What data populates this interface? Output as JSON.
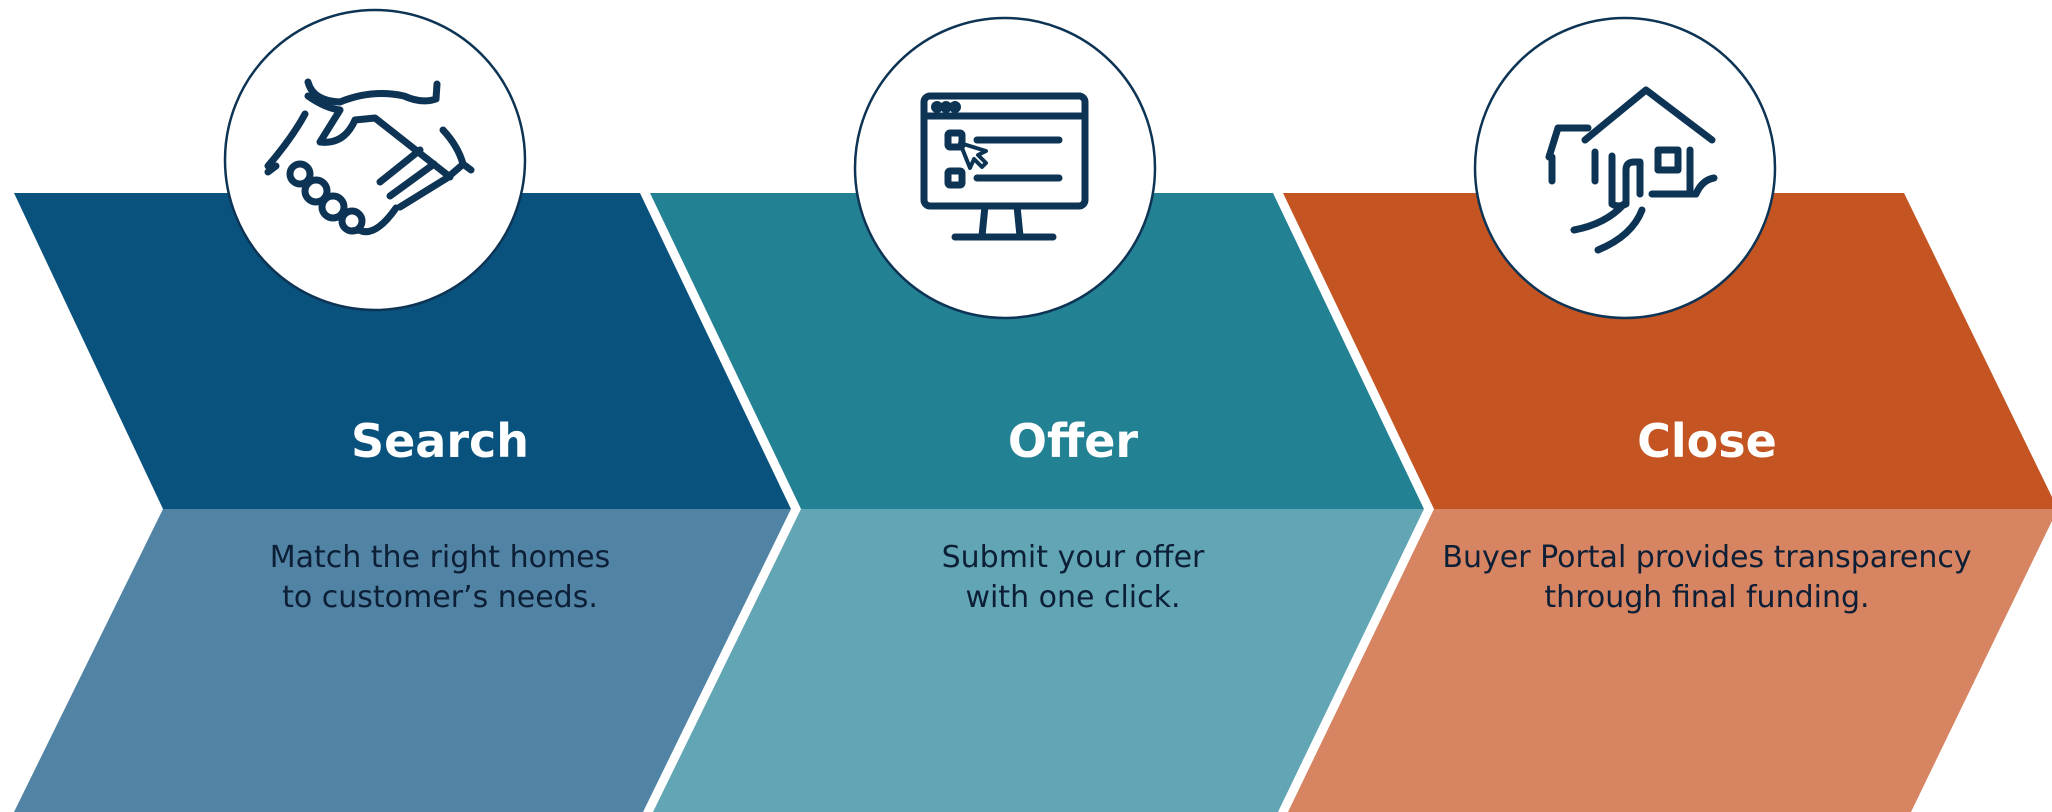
{
  "steps": [
    {
      "title": "Search",
      "description_lines": [
        "Match the right homes",
        "to customer’s needs."
      ],
      "icon": "handshake-icon",
      "top_color": "#0a527e",
      "bottom_color": "#5183a4"
    },
    {
      "title": "Offer",
      "description_lines": [
        "Submit your offer",
        "with one click."
      ],
      "icon": "computer-screen-icon",
      "top_color": "#238194",
      "bottom_color": "#62a5b4"
    },
    {
      "title": "Close",
      "description_lines": [
        "Buyer Portal provides transparency",
        "through final funding."
      ],
      "icon": "house-icon",
      "top_color": "#c45523",
      "bottom_color": "#d68461"
    }
  ],
  "colors": {
    "icon_circle_fill": "#ffffff",
    "icon_circle_stroke": "#0d3454",
    "icon_stroke": "#0d3454",
    "separator": "#ffffff"
  }
}
